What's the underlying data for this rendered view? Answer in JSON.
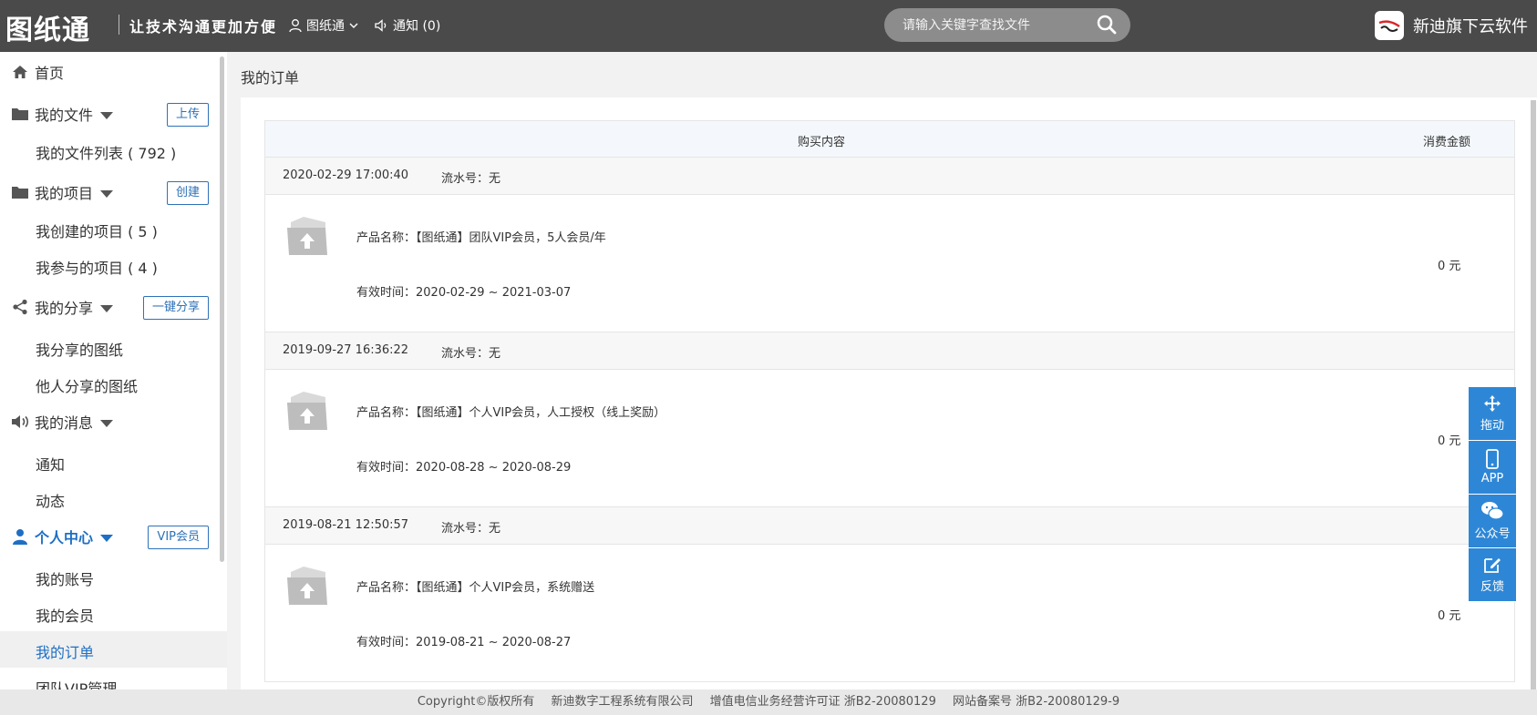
{
  "header": {
    "logo_text": "图纸通",
    "slogan": "让技术沟通更加方便",
    "user_label": "图纸通",
    "notice_label": "通知 (0)",
    "search_placeholder": "请输入关键字查找文件",
    "brand_text": "新迪旗下云软件"
  },
  "sidebar": {
    "home": "首页",
    "my_files": "我的文件",
    "upload_btn": "上传",
    "file_list": "我的文件列表 ( 792 )",
    "my_projects": "我的项目",
    "create_btn": "创建",
    "created_projects": "我创建的项目 ( 5 )",
    "joined_projects": "我参与的项目 ( 4 )",
    "my_share": "我的分享",
    "share_btn": "一键分享",
    "my_shared": "我分享的图纸",
    "others_shared": "他人分享的图纸",
    "my_messages": "我的消息",
    "notice": "通知",
    "activity": "动态",
    "personal": "个人中心",
    "vip_btn": "VIP会员",
    "account": "我的账号",
    "membership": "我的会员",
    "orders": "我的订单",
    "team_vip": "团队VIP管理"
  },
  "main": {
    "title": "我的订单",
    "col_content": "购买内容",
    "col_amount": "消费金额",
    "orders": [
      {
        "date": "2020-02-29 17:00:40",
        "serial": "流水号：无",
        "name": "产品名称：【图纸通】团队VIP会员，5人会员/年",
        "valid": "有效时间：2020-02-29 ~ 2021-03-07",
        "amount": "0 元"
      },
      {
        "date": "2019-09-27 16:36:22",
        "serial": "流水号：无",
        "name": "产品名称：【图纸通】个人VIP会员，人工授权（线上奖励）",
        "valid": "有效时间：2020-08-28 ~ 2020-08-29",
        "amount": "0 元"
      },
      {
        "date": "2019-08-21 12:50:57",
        "serial": "流水号：无",
        "name": "产品名称：【图纸通】个人VIP会员，系统赠送",
        "valid": "有效时间：2019-08-21 ~ 2020-08-27",
        "amount": "0 元"
      }
    ]
  },
  "float": {
    "drag": "拖动",
    "app": "APP",
    "wechat": "公众号",
    "feedback": "反馈"
  },
  "footer": {
    "copyright": "Copyright©版权所有",
    "company": "新迪数字工程系统有限公司",
    "license": "增值电信业务经营许可证  浙B2-20080129",
    "icp": "网站备案号  浙B2-20080129-9"
  },
  "colors": {
    "header_bg": "#4a4a4a",
    "accent_blue": "#1e6fc4",
    "float_blue": "#2e87d6"
  }
}
